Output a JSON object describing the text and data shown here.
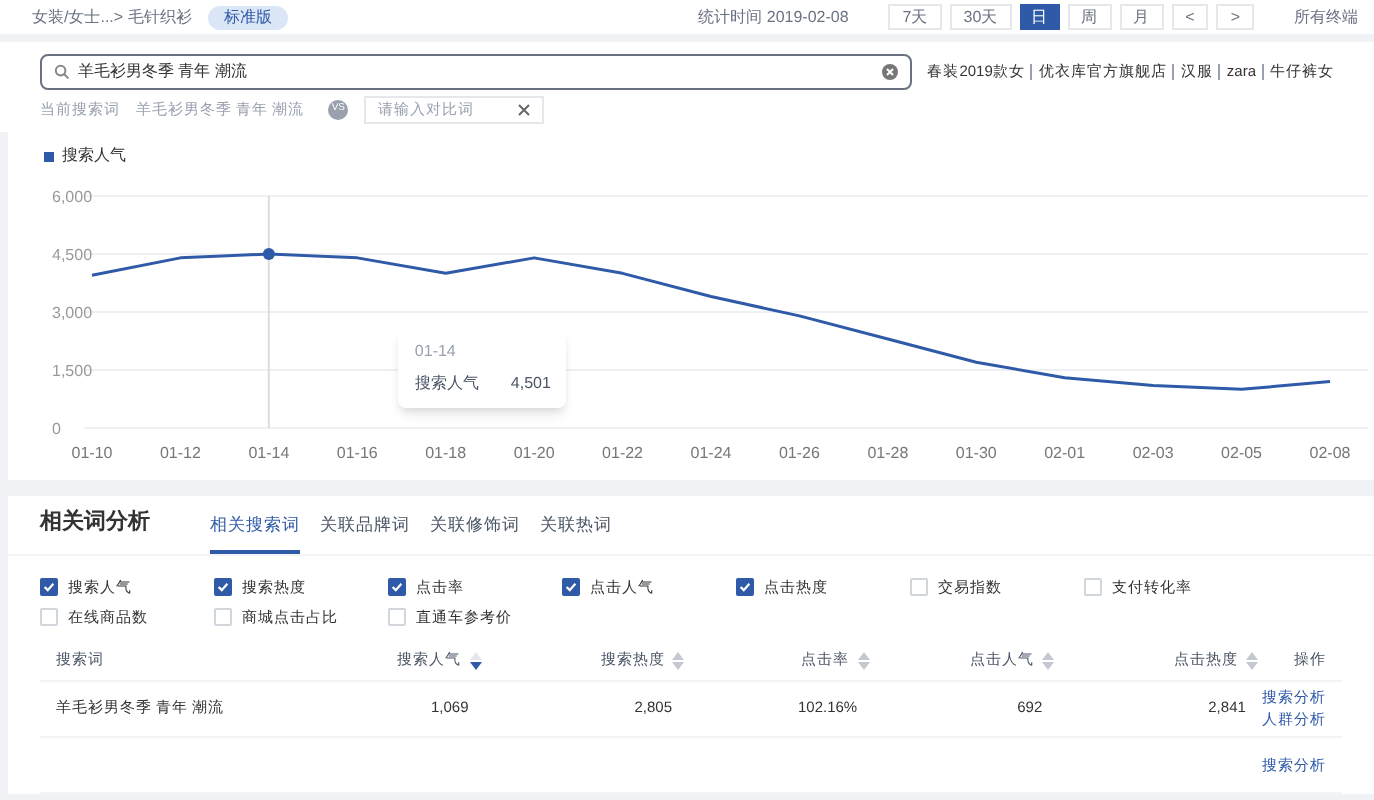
{
  "header": {
    "breadcrumb": "女装/女士...> 毛针织衫",
    "edition_badge": "标准版",
    "stat_time": "统计时间 2019-02-08",
    "periods": [
      {
        "label": "7天",
        "selected": false
      },
      {
        "label": "30天",
        "selected": false
      },
      {
        "label": "日",
        "selected": true
      },
      {
        "label": "周",
        "selected": false
      },
      {
        "label": "月",
        "selected": false
      }
    ],
    "prev": "<",
    "next": ">",
    "terminal": "所有终端"
  },
  "search": {
    "value": "羊毛衫男冬季 青年 潮流",
    "suggestions": [
      "春装2019款女",
      "优衣库官方旗舰店",
      "汉服",
      "zara",
      "牛仔裤女"
    ],
    "current_label": "当前搜索词",
    "current_value": "羊毛衫男冬季 青年 潮流",
    "vs": "VS",
    "compare_placeholder": "请输入对比词"
  },
  "trend": {
    "chart_data": {
      "type": "line",
      "categories": [
        "01-10",
        "01-12",
        "01-14",
        "01-16",
        "01-18",
        "01-20",
        "01-22",
        "01-24",
        "01-26",
        "01-28",
        "01-30",
        "02-01",
        "02-03",
        "02-05",
        "02-08"
      ],
      "series": [
        {
          "name": "搜索人气",
          "color": "#2f5aa8",
          "values": [
            3950,
            4400,
            4500,
            4400,
            4000,
            4400,
            4000,
            3400,
            2900,
            2300,
            1700,
            1300,
            1100,
            1000,
            1200
          ]
        }
      ],
      "ylim": [
        0,
        6000
      ],
      "yticks": [
        {
          "value": 0,
          "label": "0"
        },
        {
          "value": 1500,
          "label": "1,500"
        },
        {
          "value": 3000,
          "label": "3,000"
        },
        {
          "value": 4500,
          "label": "4,500"
        },
        {
          "value": 6000,
          "label": "6,000"
        }
      ],
      "grid": true,
      "ref_lines": [
        {
          "axis": "x",
          "value": "01-14"
        }
      ]
    },
    "tooltip": {
      "date": "01-14",
      "name": "搜索人气",
      "value": "4,501"
    }
  },
  "related": {
    "title": "相关词分析",
    "tabs": [
      {
        "label": "相关搜索词",
        "selected": true
      },
      {
        "label": "关联品牌词",
        "selected": false
      },
      {
        "label": "关联修饰词",
        "selected": false
      },
      {
        "label": "关联热词",
        "selected": false
      }
    ],
    "metrics": [
      {
        "label": "搜索人气",
        "checked": true
      },
      {
        "label": "搜索热度",
        "checked": true
      },
      {
        "label": "点击率",
        "checked": true
      },
      {
        "label": "点击人气",
        "checked": true
      },
      {
        "label": "点击热度",
        "checked": true
      },
      {
        "label": "交易指数",
        "checked": false
      },
      {
        "label": "支付转化率",
        "checked": false
      },
      {
        "label": "在线商品数",
        "checked": false
      },
      {
        "label": "商城点击占比",
        "checked": false
      },
      {
        "label": "直通车参考价",
        "checked": false
      }
    ],
    "columns": [
      {
        "label": "搜索词",
        "sortable": false
      },
      {
        "label": "搜索人气",
        "sortable": true,
        "sorted": true
      },
      {
        "label": "搜索热度",
        "sortable": true,
        "sorted": false
      },
      {
        "label": "点击率",
        "sortable": true,
        "sorted": false
      },
      {
        "label": "点击人气",
        "sortable": true,
        "sorted": false
      },
      {
        "label": "点击热度",
        "sortable": true,
        "sorted": false
      },
      {
        "label": "操作",
        "sortable": false
      }
    ],
    "rows": [
      {
        "cells": [
          "羊毛衫男冬季 青年 潮流",
          "1,069",
          "2,805",
          "102.16%",
          "692",
          "2,841"
        ],
        "actions": [
          "搜索分析",
          "人群分析"
        ]
      },
      {
        "cells": [],
        "actions": [
          "搜索分析"
        ]
      }
    ]
  }
}
